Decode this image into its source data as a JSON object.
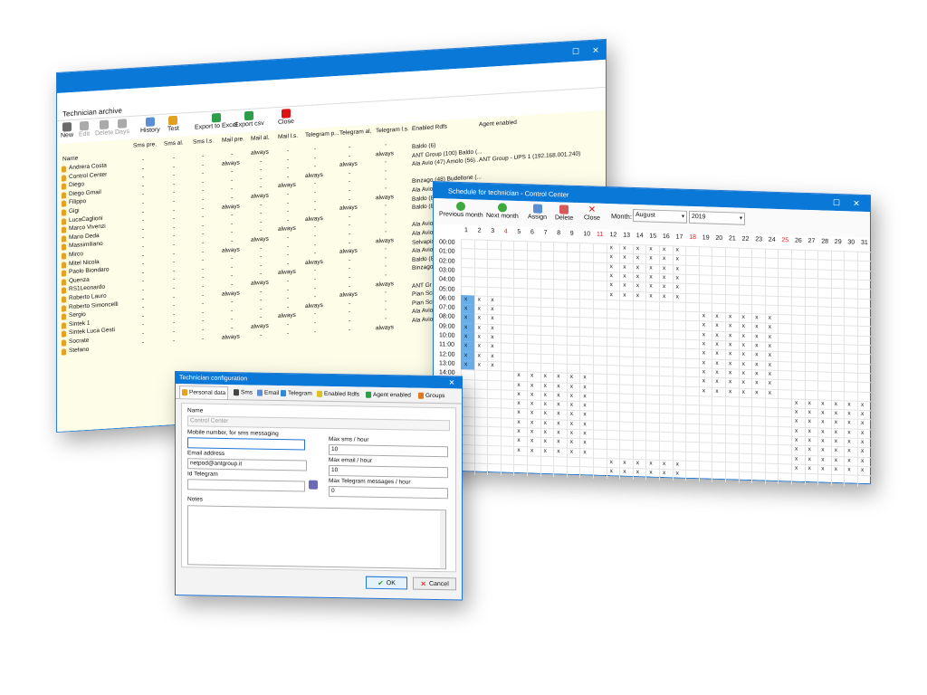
{
  "archive": {
    "title": "Technician archive",
    "toolbar": [
      "New",
      "Edit",
      "Delete",
      "Days",
      "History",
      "Test",
      "Export to Excel",
      "Export csv",
      "Close"
    ],
    "columns": [
      "Name",
      "Sms pre.",
      "Sms al.",
      "Sms l.s.",
      "Mail pre.",
      "Mail al.",
      "Mail l.s.",
      "Telegram p...",
      "Telegram al.",
      "Telegram l.s.",
      "Enabled Rdfs",
      "Agent enabled"
    ],
    "names": [
      "Andrera Costa",
      "Control Center",
      "Diego",
      "Diego Gmail",
      "Filippo",
      "Gigi",
      "LucaCaglioni",
      "Marco Vivenzi",
      "Mario Deda",
      "Massimiliano",
      "Mirco",
      "Mitel Nicola",
      "Paolo Biondaro",
      "Quenza",
      "RS1Leonardo",
      "Roberto Lauro",
      "Roberto Simoncelli",
      "Sergio",
      "Sintek 1",
      "Sintek Luca Gesti",
      "Socrate",
      "Stefano"
    ],
    "rdfs": [
      "Baldo (6)",
      "ANT Group (100) Baldo (...",
      "Ala Avio (47) Amolo (56)...",
      "",
      "Binzago (48) Budellone (...",
      "Ala Avio",
      "Baldo (8",
      "Baldo (8",
      "",
      "Ala Avio",
      "Ala Avio",
      "Selvapia",
      "Ala Avio",
      "Baldo (8",
      "Binzago",
      "",
      "ANT Gr",
      "Pian Sci",
      "Pian Sci",
      "Ala Avio",
      "Ala Avio"
    ],
    "agent": "ANT Group - UPS 1 (192.168.001.240)",
    "always": "always",
    "dash": "-"
  },
  "schedule": {
    "title": "Schedule for technician - Control Center",
    "toolbar": [
      "Previous month",
      "Next month",
      "Assign",
      "Delete",
      "Close"
    ],
    "month_label": "Month:",
    "month": "August",
    "year": "2019",
    "days": [
      "1",
      "2",
      "3",
      "4",
      "5",
      "6",
      "7",
      "8",
      "9",
      "10",
      "11",
      "12",
      "13",
      "14",
      "15",
      "16",
      "17",
      "18",
      "19",
      "20",
      "21",
      "22",
      "23",
      "24",
      "25",
      "26",
      "27",
      "28",
      "29",
      "30",
      "31"
    ],
    "red_days": [
      "4",
      "11",
      "18",
      "25"
    ],
    "hours": [
      "00:00",
      "01:00",
      "02:00",
      "03:00",
      "04:00",
      "05:00",
      "06:00",
      "07:00",
      "08:00",
      "09:00",
      "10:00",
      "11:00",
      "12:00",
      "13:00",
      "14:00",
      "15:00"
    ],
    "mark": "x"
  },
  "config": {
    "title": "Technician configuration",
    "tabs": [
      "Personal data",
      "Sms",
      "Email",
      "Telegram",
      "Enabled Rdfs",
      "Agent enabled",
      "Groups"
    ],
    "name_label": "Name",
    "name_value": "Control Center",
    "mobile_label": "Mobile number, for sms messaging",
    "email_label": "Email address",
    "email_value": "netpod@antgroup.it",
    "telegram_label": "Id Telegram",
    "max_sms_label": "Max sms / hour",
    "max_sms_value": "10",
    "max_email_label": "Max email / hour",
    "max_email_value": "10",
    "max_tg_label": "Max Telegram messages / hour",
    "max_tg_value": "0",
    "notes_label": "Notes",
    "ok": "OK",
    "cancel": "Cancel"
  }
}
